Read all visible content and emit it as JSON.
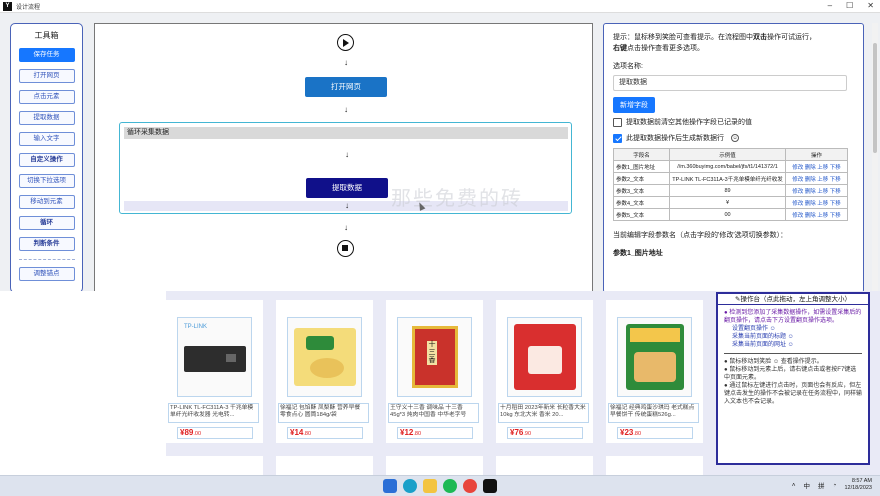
{
  "window": {
    "title": "设计流程",
    "app_icon": "Y"
  },
  "toolbox": {
    "title": "工具箱",
    "items": [
      "保存任务",
      "打开网页",
      "点击元素",
      "提取数据",
      "输入文字",
      "自定义操作",
      "切换下拉选项",
      "移动到元素",
      "循环",
      "判断条件",
      "调整锚点"
    ]
  },
  "flow": {
    "open_page": "打开网页",
    "loop_title": "循环采集数据",
    "extract": "提取数据",
    "watermark": "那些免费的砖"
  },
  "panel": {
    "hint_prefix": "提示：鼠标移到笑脸可查看提示。在流程图中",
    "hint_dbl": "双击",
    "hint_mid": "操作可试运行，",
    "hint_right": "右键",
    "hint_suffix": "点击操作查看更多选项。",
    "option_label": "选项名称:",
    "option_value": "提取数据",
    "add_field": "新增字段",
    "clear_check": "提取数据前清空其他操作字段已记录的值",
    "new_row_check": "此提取数据操作后生成新数据行",
    "columns": [
      "字段名",
      "示例值",
      "操作"
    ],
    "rows": [
      {
        "name": "参数1_图片地址",
        "value": "//m.360buyimg.com/babel/jfs/t1/141372/1",
        "ops": "修改 删除 上移 下移"
      },
      {
        "name": "参数2_文本",
        "value": "TP-LINK TL-FC311A-3千兆单模单纤光纤收发",
        "ops": "修改 删除 上移 下移"
      },
      {
        "name": "参数3_文本",
        "value": "89",
        "ops": "修改 删除 上移 下移"
      },
      {
        "name": "参数4_文本",
        "value": "¥",
        "ops": "修改 删除 上移 下移"
      },
      {
        "name": "参数5_文本",
        "value": "00",
        "ops": "修改 删除 上移 下移"
      }
    ],
    "current_edit": "当前编辑字段参数名（点击字段的'修改'选项切换参数）：",
    "current_field": "参数1_图片地址"
  },
  "products": [
    {
      "caption": "TP-LINK TL-FC311A-3 千兆单模单纤光纤收发器 光电转...",
      "price": "89",
      "decimal": ".00",
      "img_tag": "TP-LINK"
    },
    {
      "caption": "徐福记 包馅酥 凤梨酥 营养早餐 零食点心 圆筒184g/袋",
      "price": "14",
      "decimal": ".80"
    },
    {
      "caption": "王守义十三香 调味品 十三香45g*3 炖肉中国香 中华老字号",
      "price": "12",
      "decimal": ".80"
    },
    {
      "caption": "十月稻田 2023年新米 长粒香大米 10kg 东北大米 香米 20...",
      "price": "76",
      "decimal": ".90"
    },
    {
      "caption": "徐福记 经典鸡蛋沙琪玛 老式糕点早餐饼干 传统蛋糕526g...",
      "price": "23",
      "decimal": ".80"
    }
  ],
  "console": {
    "title": "✎操作台（点此拖动，左上角调整大小）",
    "line1": "● 检测到您添加了采集数据操作，如需设置采集后的翻页操作，请点击下方设置翻页操作选项。",
    "link1": "设置翻页操作 ☺",
    "link2": "采集当前页面的标题 ☺",
    "link3": "采集当前页面的网址 ☺",
    "tip1": "● 鼠标移动到笑脸 ☺ 查看操作提示。",
    "tip2": "● 鼠标移动到元素上后，请右键点击或者按F7键选中页面元素。",
    "tip3": "● 通过鼠标左键进行点击时，页面也会有反应，但左键点击发生的操作不会被记录在任务流程中，同样输入文本也不会记录。"
  },
  "taskbar": {
    "tray_lang": "中",
    "tray_ime": "拼",
    "time": "8:57 AM",
    "date": "12/18/2023"
  },
  "colors": {
    "primary": "#1677ff",
    "loop_border": "#44b6d3",
    "extract_node": "#10108a",
    "open_node": "#1a73c6",
    "console_border": "#2d2d9a",
    "price": "#e02020"
  }
}
